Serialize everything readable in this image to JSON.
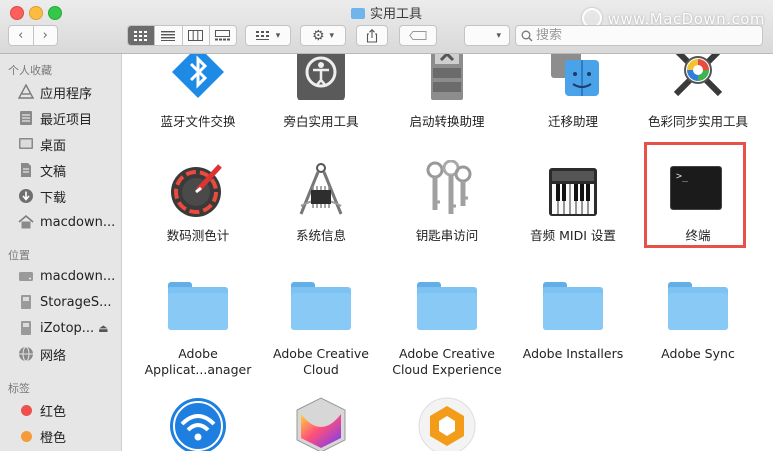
{
  "window": {
    "title": "实用工具",
    "watermark": "www.MacDown.com"
  },
  "toolbar": {
    "back_glyph": "‹",
    "forward_glyph": "›",
    "search_placeholder": "搜索",
    "icons": [
      "back-icon",
      "forward-icon",
      "icon-view-icon",
      "list-view-icon",
      "column-view-icon",
      "gallery-view-icon",
      "group-icon",
      "gear-icon",
      "share-icon",
      "tag-icon",
      "dropdown-icon",
      "search-icon"
    ]
  },
  "sidebar": {
    "favorites_header": "个人收藏",
    "favorites": [
      {
        "label": "应用程序",
        "icon": "applications-icon"
      },
      {
        "label": "最近项目",
        "icon": "recents-icon"
      },
      {
        "label": "桌面",
        "icon": "desktop-icon"
      },
      {
        "label": "文稿",
        "icon": "documents-icon"
      },
      {
        "label": "下载",
        "icon": "downloads-icon"
      },
      {
        "label": "macdown...",
        "icon": "home-icon"
      }
    ],
    "locations_header": "位置",
    "locations": [
      {
        "label": "macdown...",
        "icon": "disk-icon"
      },
      {
        "label": "StorageS...",
        "icon": "disk-icon"
      },
      {
        "label": "iZotop...",
        "icon": "disk-icon",
        "eject": "⏏"
      },
      {
        "label": "网络",
        "icon": "network-icon"
      }
    ],
    "tags_header": "标签",
    "tags": [
      {
        "label": "红色",
        "color": "#f0504c"
      },
      {
        "label": "橙色",
        "color": "#f59c3a"
      }
    ]
  },
  "content": {
    "row1": [
      "蓝牙文件交换",
      "旁白实用工具",
      "启动转换助理",
      "迁移助理",
      "色彩同步实用工具"
    ],
    "row2": [
      "数码测色计",
      "系统信息",
      "钥匙串访问",
      "音频 MIDI 设置",
      "终端"
    ],
    "row3": [
      [
        "Adobe",
        "Applicat...anager"
      ],
      [
        "Adobe Creative",
        "Cloud"
      ],
      [
        "Adobe Creative",
        "Cloud Experience"
      ],
      [
        "Adobe Installers",
        ""
      ],
      [
        "Adobe Sync",
        ""
      ]
    ],
    "terminal_prompt": ">_",
    "highlight_color": "#e8504a"
  }
}
